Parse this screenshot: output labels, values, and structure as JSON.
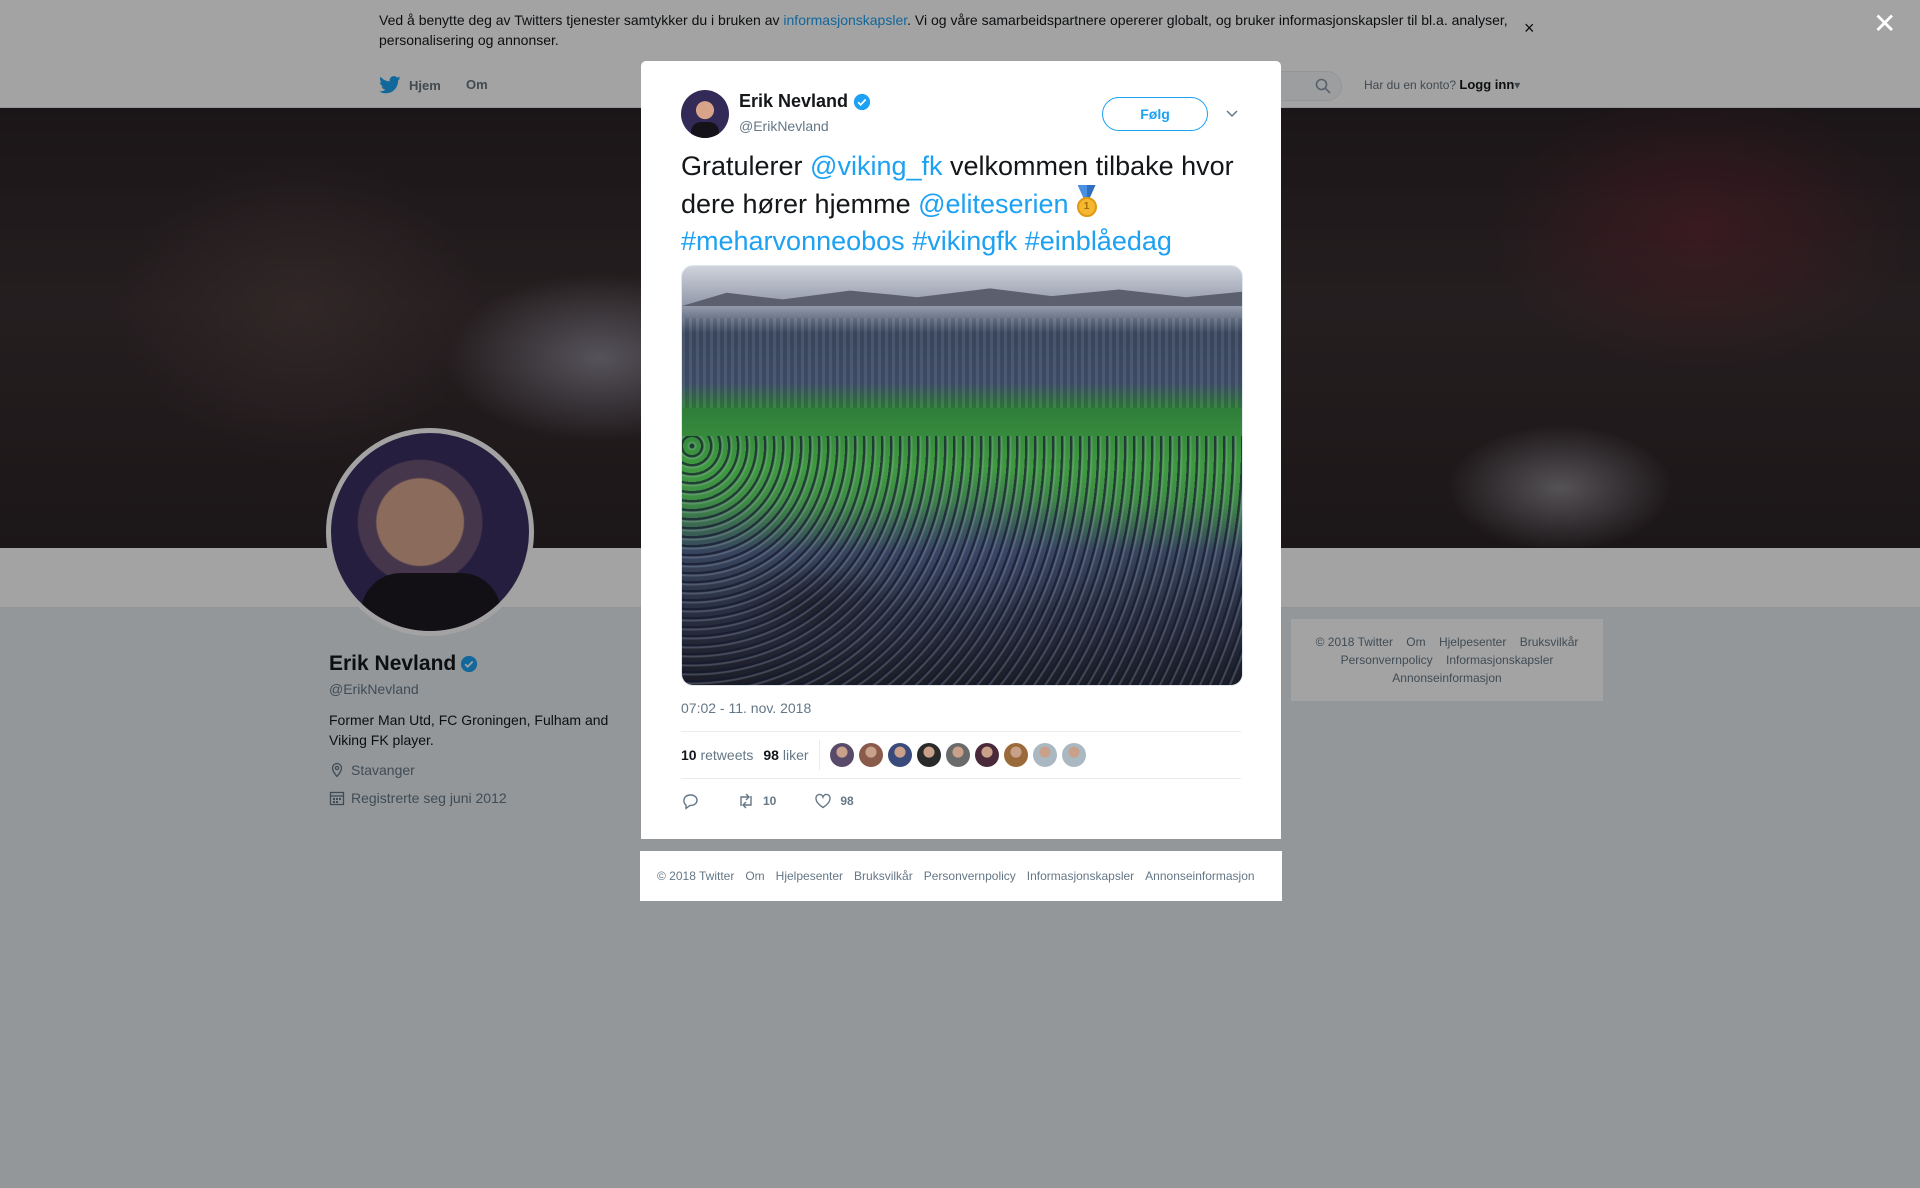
{
  "cookie": {
    "text_before": "Ved å benytte deg av Twitters tjenester samtykker du i bruken av ",
    "link": "informasjonskapsler",
    "text_after": ". Vi og våre samarbeidspartnere opererer globalt, og bruker informasjonskapsler til bl.a. analyser, personalisering og annonser.",
    "close": "×"
  },
  "nav": {
    "home": "Hjem",
    "about": "Om",
    "have_account": "Har du en konto?",
    "login": "Logg inn"
  },
  "profile": {
    "name": "Erik Nevland",
    "handle": "@ErikNevland",
    "bio": "Former Man Utd, FC Groningen, Fulham and Viking FK player.",
    "location": "Stavanger",
    "joined": "Registrerte seg juni 2012"
  },
  "side_footer": {
    "items": [
      "© 2018 Twitter",
      "Om",
      "Hjelpesenter",
      "Bruksvilkår",
      "Personvernpolicy",
      "Informasjonskapsler",
      "Annonseinformasjon"
    ]
  },
  "overlay": {
    "close": "✕"
  },
  "tweet": {
    "name": "Erik Nevland",
    "handle": "@ErikNevland",
    "follow": "Følg",
    "text": {
      "t1": "Gratulerer ",
      "m1": "@viking_fk",
      "t2": " velkommen tilbake hvor dere hører hjemme ",
      "m2": "@eliteserien",
      "h1": "#meharvonneobos",
      "h2": "#vikingfk",
      "h3": "#einblåedag"
    },
    "medal_number": "1",
    "timestamp": "07:02 - 11. nov. 2018",
    "retweets_count": "10",
    "retweets_label": "retweets",
    "likes_count": "98",
    "likes_label": "liker",
    "action_retweets": "10",
    "action_likes": "98",
    "liker_colors": [
      "#5a4a6a",
      "#8a5a4a",
      "#3a4a7a",
      "#2a2a2a",
      "#6a6a6a",
      "#4a2a3a",
      "#9a6a3a",
      "#aab8c2",
      "#aab8c2"
    ]
  },
  "modal_footer": {
    "items": [
      "© 2018 Twitter",
      "Om",
      "Hjelpesenter",
      "Bruksvilkår",
      "Personvernpolicy",
      "Informasjonskapsler",
      "Annonseinformasjon"
    ]
  },
  "colors": {
    "accent": "#1da1f2",
    "text": "#14171a",
    "muted": "#657786"
  }
}
